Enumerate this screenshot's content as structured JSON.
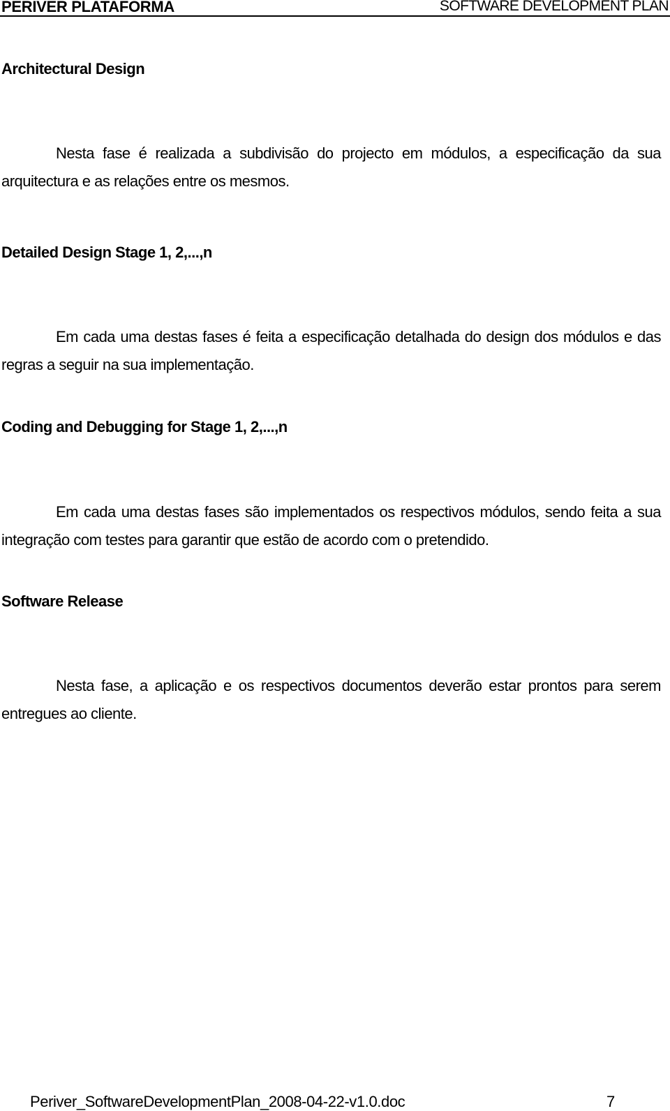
{
  "header": {
    "left": "PERIVER PLATAFORMA",
    "right": "SOFTWARE DEVELOPMENT PLAN"
  },
  "sections": [
    {
      "heading": "Architectural Design",
      "body": "Nesta fase é realizada a subdivisão do projecto em módulos, a especificação da sua arquitectura e as relações entre os mesmos."
    },
    {
      "heading": "Detailed Design Stage 1, 2,...,n",
      "body": "Em cada uma destas fases é feita a especificação detalhada do design dos módulos e das regras a seguir na sua implementação."
    },
    {
      "heading": "Coding and Debugging for Stage 1, 2,...,n",
      "body": "Em cada uma destas fases são implementados os respectivos módulos, sendo feita a sua integração com testes para garantir que estão de acordo com o pretendido."
    },
    {
      "heading": "Software Release",
      "body": "Nesta fase, a aplicação e os respectivos documentos deverão estar prontos para serem entregues ao cliente."
    }
  ],
  "footer": {
    "filename": "Periver_SoftwareDevelopmentPlan_2008-04-22-v1.0.doc",
    "page_number": "7"
  }
}
